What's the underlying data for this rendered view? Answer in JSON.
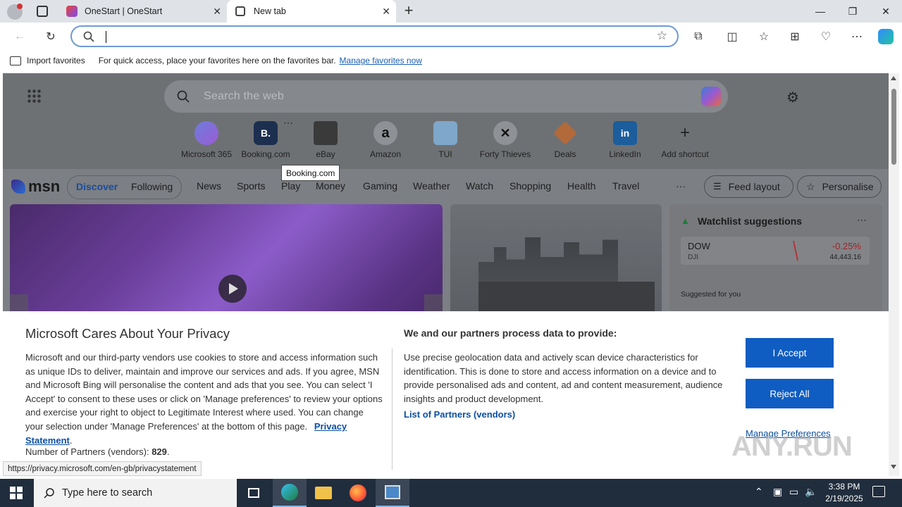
{
  "browser": {
    "tabs": [
      {
        "title": "OneStart | OneStart"
      },
      {
        "title": "New tab"
      }
    ],
    "favorites_bar": {
      "import_label": "Import favorites",
      "message": "For quick access, place your favorites here on the favorites bar.",
      "manage_link": "Manage favorites now"
    }
  },
  "ntp": {
    "search_placeholder": "Search the web",
    "shortcuts": [
      {
        "label": "Microsoft 365",
        "glyph": ""
      },
      {
        "label": "Booking.com",
        "glyph": "B."
      },
      {
        "label": "eBay",
        "glyph": ""
      },
      {
        "label": "Amazon",
        "glyph": "a"
      },
      {
        "label": "TUI",
        "glyph": ""
      },
      {
        "label": "Forty Thieves",
        "glyph": ""
      },
      {
        "label": "Deals",
        "glyph": ""
      },
      {
        "label": "LinkedIn",
        "glyph": "in"
      },
      {
        "label": "Add shortcut",
        "glyph": "+"
      }
    ],
    "tooltip": "Booking.com"
  },
  "msn": {
    "logo": "msn",
    "tabs": [
      "Discover",
      "Following"
    ],
    "nav": [
      "News",
      "Sports",
      "Play",
      "Money",
      "Gaming",
      "Weather",
      "Watch",
      "Shopping",
      "Health",
      "Travel"
    ],
    "more": "···",
    "feed_layout": "Feed layout",
    "personalise": "Personalise",
    "watchlist": {
      "title": "Watchlist suggestions",
      "ticker": "DOW",
      "exchange": "DJI",
      "change": "-0.25%",
      "value": "44,443.16",
      "suggested_label": "Suggested for you"
    }
  },
  "privacy": {
    "title": "Microsoft Cares About Your Privacy",
    "body": "Microsoft and our third-party vendors use cookies to store and access information such as unique IDs to deliver, maintain and improve our services and ads. If you agree, MSN and Microsoft Bing will personalise the content and ads that you see. You can select 'I Accept' to consent to these uses or click on 'Manage preferences' to review your options and exercise your right to object to Legitimate Interest where used.  You can change your selection under 'Manage Preferences' at the bottom of this page.",
    "privacy_link": "Privacy Statement",
    "partners_label": "Number of Partners (vendors): ",
    "partners_count": "829",
    "data_heading": "We and our partners process data to provide:",
    "data_body": "Use precise geolocation data and actively scan device characteristics for identification. This is done to store and access information on a device and to provide personalised ads and content, ad and content measurement, audience insights and product development.",
    "vendors_link": "List of Partners (vendors)",
    "accept": "I Accept",
    "reject": "Reject All",
    "manage": "Manage Preferences"
  },
  "status_url": "https://privacy.microsoft.com/en-gb/privacystatement",
  "watermark": "ANY.RUN",
  "taskbar": {
    "search_placeholder": "Type here to search",
    "time": "3:38 PM",
    "date": "2/19/2025"
  }
}
